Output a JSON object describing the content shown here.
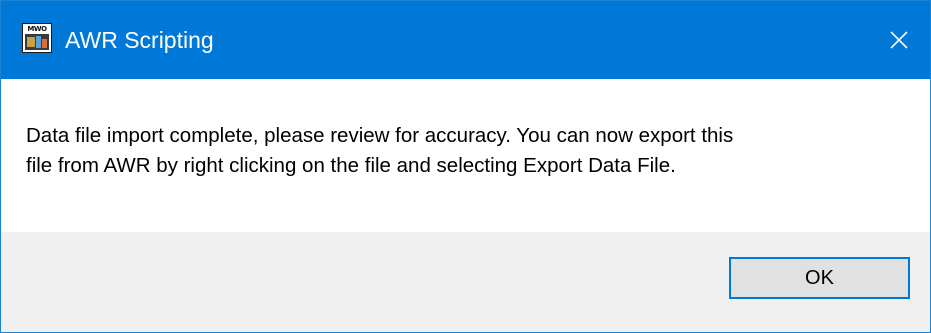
{
  "window": {
    "title": "AWR Scripting",
    "app_icon_label": "MWO",
    "close_icon": "close-icon"
  },
  "message": {
    "text": "Data file import complete, please review for accuracy.  You can now export this\nfile from AWR by right clicking on the file and selecting Export Data File."
  },
  "buttons": {
    "ok_label": "OK"
  },
  "colors": {
    "titlebar": "#0078d7",
    "button_area": "#f0f0f0",
    "button_face": "#e1e1e1",
    "focus_border": "#0078d7"
  }
}
